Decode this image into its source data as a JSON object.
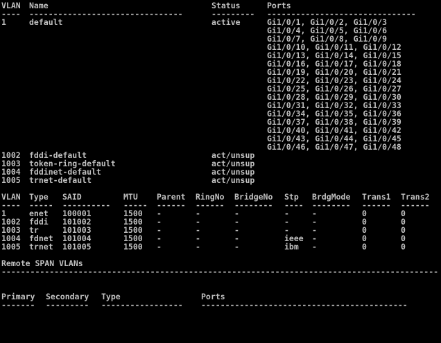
{
  "vlan_brief": {
    "headers": [
      "VLAN",
      "Name",
      "Status",
      "Ports"
    ],
    "rows": [
      {
        "vlan": "1",
        "name": "default",
        "status": "active",
        "ports": [
          "Gi1/0/1, Gi1/0/2, Gi1/0/3",
          "Gi1/0/4, Gi1/0/5, Gi1/0/6",
          "Gi1/0/7, Gi1/0/8, Gi1/0/9",
          "Gi1/0/10, Gi1/0/11, Gi1/0/12",
          "Gi1/0/13, Gi1/0/14, Gi1/0/15",
          "Gi1/0/16, Gi1/0/17, Gi1/0/18",
          "Gi1/0/19, Gi1/0/20, Gi1/0/21",
          "Gi1/0/22, Gi1/0/23, Gi1/0/24",
          "Gi1/0/25, Gi1/0/26, Gi1/0/27",
          "Gi1/0/28, Gi1/0/29, Gi1/0/30",
          "Gi1/0/31, Gi1/0/32, Gi1/0/33",
          "Gi1/0/34, Gi1/0/35, Gi1/0/36",
          "Gi1/0/37, Gi1/0/38, Gi1/0/39",
          "Gi1/0/40, Gi1/0/41, Gi1/0/42",
          "Gi1/0/43, Gi1/0/44, Gi1/0/45",
          "Gi1/0/46, Gi1/0/47, Gi1/0/48"
        ]
      },
      {
        "vlan": "1002",
        "name": "fddi-default",
        "status": "act/unsup",
        "ports": []
      },
      {
        "vlan": "1003",
        "name": "token-ring-default",
        "status": "act/unsup",
        "ports": []
      },
      {
        "vlan": "1004",
        "name": "fddinet-default",
        "status": "act/unsup",
        "ports": []
      },
      {
        "vlan": "1005",
        "name": "trnet-default",
        "status": "act/unsup",
        "ports": []
      }
    ]
  },
  "vlan_detail": {
    "headers": [
      "VLAN",
      "Type",
      "SAID",
      "MTU",
      "Parent",
      "RingNo",
      "BridgeNo",
      "Stp",
      "BrdgMode",
      "Trans1",
      "Trans2"
    ],
    "rows": [
      [
        "1",
        "enet",
        "100001",
        "1500",
        "-",
        "-",
        "-",
        "-",
        "-",
        "0",
        "0"
      ],
      [
        "1002",
        "fddi",
        "101002",
        "1500",
        "-",
        "-",
        "-",
        "-",
        "-",
        "0",
        "0"
      ],
      [
        "1003",
        "tr",
        "101003",
        "1500",
        "-",
        "-",
        "-",
        "-",
        "-",
        "0",
        "0"
      ],
      [
        "1004",
        "fdnet",
        "101004",
        "1500",
        "-",
        "-",
        "-",
        "ieee",
        "-",
        "0",
        "0"
      ],
      [
        "1005",
        "trnet",
        "101005",
        "1500",
        "-",
        "-",
        "-",
        "ibm",
        "-",
        "0",
        "0"
      ]
    ]
  },
  "remote_span": {
    "title": "Remote SPAN VLANs"
  },
  "private_vlan": {
    "headers": [
      "Primary",
      "Secondary",
      "Type",
      "Ports"
    ]
  },
  "rule_char": "-"
}
